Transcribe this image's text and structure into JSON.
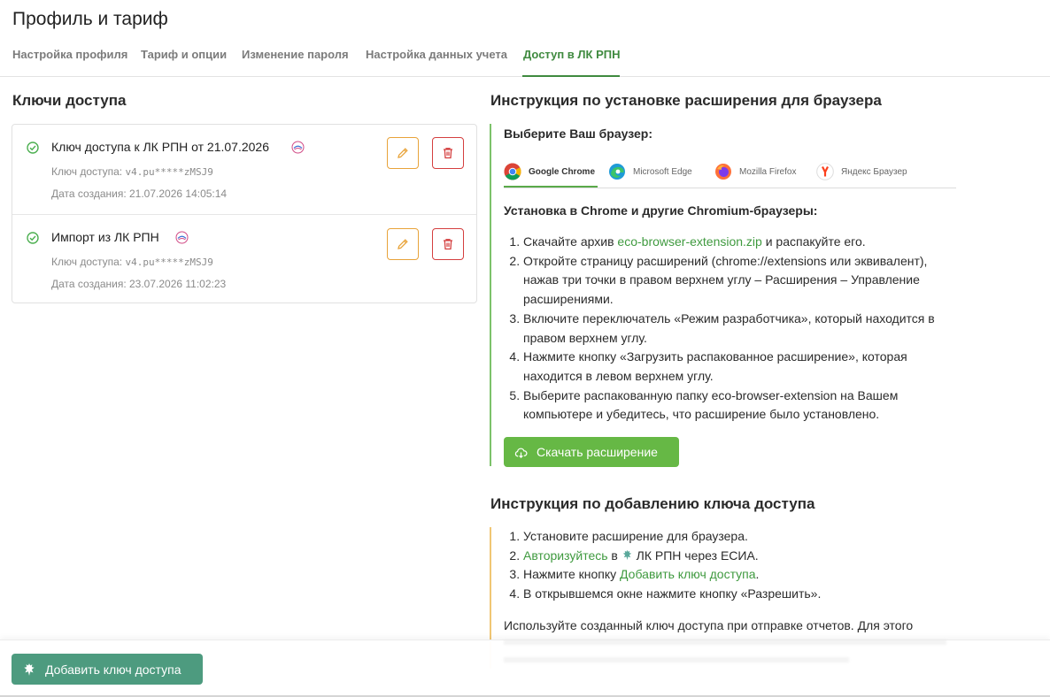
{
  "page": {
    "title": "Профиль и тариф"
  },
  "tabs": [
    {
      "label": "Настройка профиля"
    },
    {
      "label": "Тариф и опции"
    },
    {
      "label": "Изменение пароля"
    },
    {
      "label": "Настройка данных учета"
    },
    {
      "label": "Доступ в ЛК РПН",
      "active": true
    }
  ],
  "keys": {
    "heading": "Ключи доступа",
    "items": [
      {
        "title": "Ключ доступа к ЛК РПН от 21.07.2026",
        "key_label": "Ключ доступа:",
        "key_value": "v4.pu*****zMSJ9",
        "created_label": "Дата создания:",
        "created_value": "21.07.2026 14:05:14",
        "status_icon": "check-circle-icon"
      },
      {
        "title": "Импорт из ЛК РПН",
        "key_label": "Ключ доступа:",
        "key_value": "v4.pu*****zMSJ9",
        "created_label": "Дата создания:",
        "created_value": "23.07.2026 11:02:23",
        "status_icon": "check-circle-icon"
      }
    ]
  },
  "install": {
    "heading": "Инструкция по установке расширения для браузера",
    "choose_label": "Выберите Ваш браузер:",
    "browsers": [
      {
        "label": "Google Chrome",
        "icon": "chrome-icon",
        "active": true
      },
      {
        "label": "Microsoft Edge",
        "icon": "edge-icon"
      },
      {
        "label": "Mozilla Firefox",
        "icon": "firefox-icon"
      },
      {
        "label": "Яндекс Браузер",
        "icon": "yandex-icon"
      }
    ],
    "subheading": "Установка в Chrome и другие Chromium-браузеры:",
    "step1_pre": "Скачайте архив ",
    "step1_link": "eco-browser-extension.zip",
    "step1_post": " и распакуйте его.",
    "step2": "Откройте страницу расширений (chrome://extensions или эквивалент), нажав три точки в правом верхнем углу – Расширения – Управление расширениями.",
    "step3": "Включите переключатель «Режим разработчика», который находится в правом верхнем углу.",
    "step4": "Нажмите кнопку «Загрузить распакованное расширение», которая находится в левом верхнем углу.",
    "step5": "Выберите распакованную папку eco-browser-extension на Вашем компьютере и убедитесь, что расширение было установлено.",
    "download_label": "Скачать расширение"
  },
  "add_key": {
    "heading": "Инструкция по добавлению ключа доступа",
    "step1": "Установите расширение для браузера.",
    "step2_link": "Авторизуйтесь",
    "step2_mid": " в ",
    "step2_post": " ЛК РПН через ЕСИА.",
    "step3_pre": "Нажмите кнопку ",
    "step3_link": "Добавить ключ доступа",
    "step3_post": ".",
    "step4": "В открывшемся окне нажмите кнопку «Разрешить».",
    "usage_text": "Используйте созданный ключ доступа при отправке отчетов. Для этого"
  },
  "footer": {
    "add_button_label": "Добавить ключ доступа"
  },
  "colors": {
    "accent": "#3f8a3f",
    "download": "#66b845",
    "add_button": "#4d9b7f",
    "edit": "#e8a33a",
    "delete": "#d43f3f"
  }
}
